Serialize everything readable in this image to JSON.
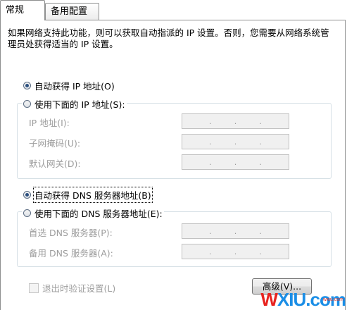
{
  "tabs": [
    {
      "label": "常规",
      "active": true
    },
    {
      "label": "备用配置",
      "active": false
    }
  ],
  "description": "如果网络支持此功能，则可以获取自动指派的 IP 设置。否则，您需要从网络系统管理员处获得适当的 IP 设置。",
  "ip": {
    "auto_label": "自动获得 IP 地址(O)",
    "auto_checked": true,
    "manual_label": "使用下面的 IP 地址(S):",
    "manual_checked": false,
    "fields": [
      {
        "label": "IP 地址(I):",
        "value": ". . ."
      },
      {
        "label": "子网掩码(U):",
        "value": ". . ."
      },
      {
        "label": "默认网关(D):",
        "value": ". . ."
      }
    ]
  },
  "dns": {
    "auto_label": "自动获得 DNS 服务器地址(B)",
    "auto_checked": true,
    "manual_label": "使用下面的 DNS 服务器地址(E):",
    "manual_checked": false,
    "fields": [
      {
        "label": "首选 DNS 服务器(P):",
        "value": ". . ."
      },
      {
        "label": "备用 DNS 服务器(A):",
        "value": ". . ."
      }
    ]
  },
  "validate_label": "退出时验证设置(L)",
  "advanced_label": "高级(V)...",
  "watermark": {
    "text_w": "W",
    "text_rest": "XIU.com",
    "sub": "wxiu.com"
  }
}
